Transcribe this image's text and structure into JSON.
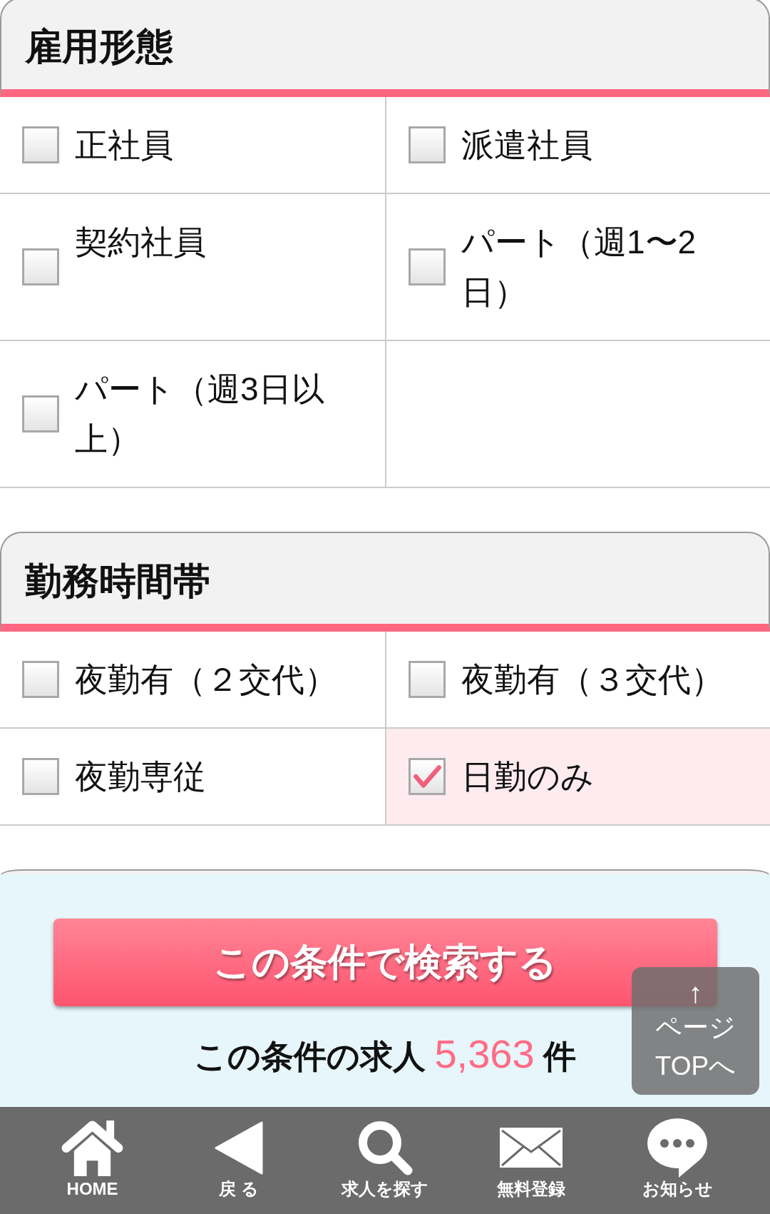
{
  "sections": [
    {
      "title": "雇用形態",
      "options": [
        {
          "label": "正社員",
          "checked": false
        },
        {
          "label": "派遣社員",
          "checked": false
        },
        {
          "label": "契約社員",
          "checked": false
        },
        {
          "label": "パート（週1〜2日）",
          "checked": false
        },
        {
          "label": "パート（週3日以上）",
          "checked": false
        }
      ]
    },
    {
      "title": "勤務時間帯",
      "options": [
        {
          "label": "夜勤有（２交代）",
          "checked": false
        },
        {
          "label": "夜勤有（３交代）",
          "checked": false
        },
        {
          "label": "夜勤専従",
          "checked": false
        },
        {
          "label": "日勤のみ",
          "checked": true
        }
      ]
    }
  ],
  "search_panel": {
    "search_button": "この条件で検索する",
    "result": {
      "prefix": "この条件の求人",
      "count": "5,363",
      "suffix": "件"
    },
    "page_top_button": {
      "arrow": "↑",
      "lines": [
        "ページ",
        "TOPへ"
      ]
    }
  },
  "bottom_nav": [
    {
      "kind": "home",
      "label": "HOME"
    },
    {
      "kind": "back",
      "label": "戻 る"
    },
    {
      "kind": "search",
      "label": "求人を探す"
    },
    {
      "kind": "mail",
      "label": "無料登録"
    },
    {
      "kind": "chat",
      "label": "お知らせ"
    }
  ]
}
